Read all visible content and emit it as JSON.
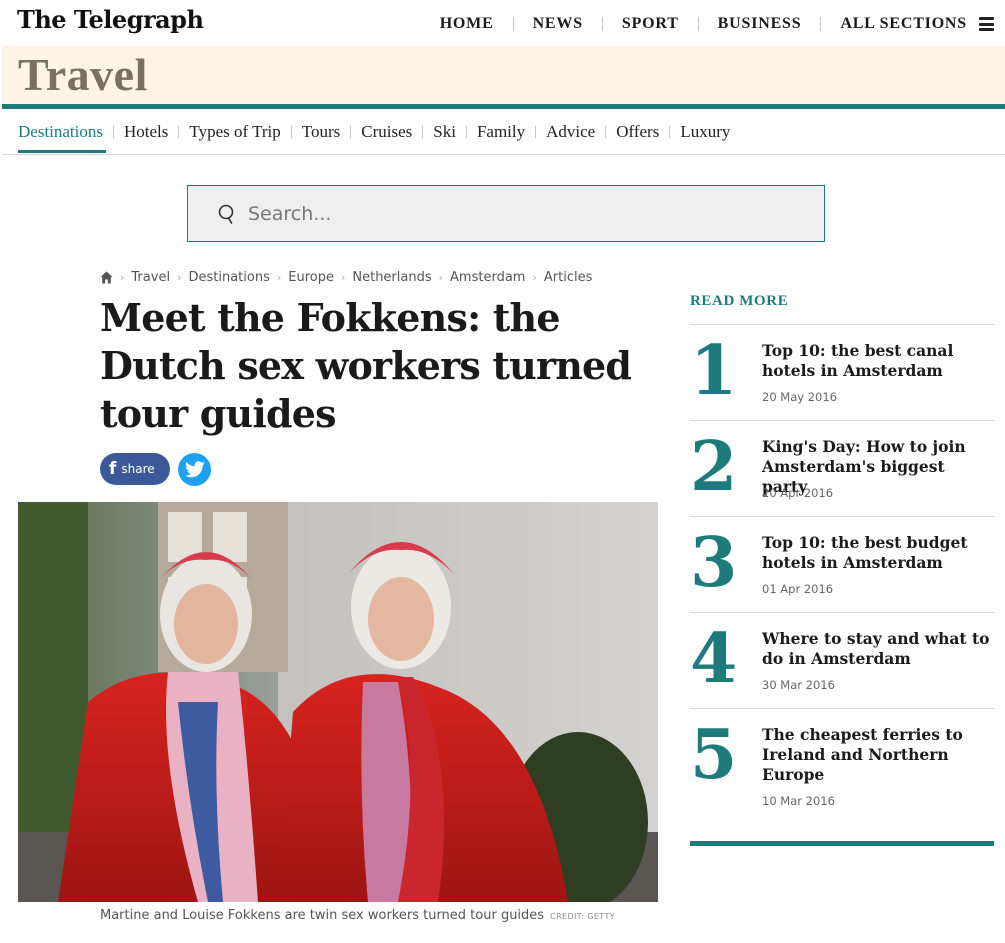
{
  "header": {
    "logo": "The Telegraph",
    "nav": [
      "HOME",
      "NEWS",
      "SPORT",
      "BUSINESS",
      "ALL SECTIONS"
    ],
    "menu_icon": "hamburger-icon"
  },
  "section": {
    "title": "Travel",
    "subnav": [
      "Destinations",
      "Hotels",
      "Types of Trip",
      "Tours",
      "Cruises",
      "Ski",
      "Family",
      "Advice",
      "Offers",
      "Luxury"
    ],
    "active_subnav": "Destinations",
    "accent_color": "#1e7b7b",
    "band_color": "#fdf5e4"
  },
  "search": {
    "placeholder": "Search...",
    "icon": "search-icon"
  },
  "breadcrumb": {
    "home_icon": "home-icon",
    "items": [
      "Travel",
      "Destinations",
      "Europe",
      "Netherlands",
      "Amsterdam",
      "Articles"
    ]
  },
  "article": {
    "headline": "Meet the Fokkens: the Dutch sex workers turned tour guides",
    "share_label": "share",
    "facebook_icon": "facebook-icon",
    "twitter_icon": "twitter-icon",
    "caption": "Martine and Louise Fokkens are twin sex workers turned tour guides",
    "credit": "CREDIT: GETTY"
  },
  "read_more": {
    "title": "READ MORE",
    "items": [
      {
        "num": "1",
        "title": "Top 10: the best canal hotels in Amsterdam",
        "date": "20 May 2016"
      },
      {
        "num": "2",
        "title": "King's Day: How to join Amsterdam's biggest party",
        "date": "20 Apr 2016"
      },
      {
        "num": "3",
        "title": "Top 10: the best budget hotels in Amsterdam",
        "date": "01 Apr 2016"
      },
      {
        "num": "4",
        "title": "Where to stay and what to do in Amsterdam",
        "date": "30 Mar 2016"
      },
      {
        "num": "5",
        "title": "The cheapest ferries to Ireland and Northern Europe",
        "date": "10 Mar 2016"
      }
    ]
  }
}
